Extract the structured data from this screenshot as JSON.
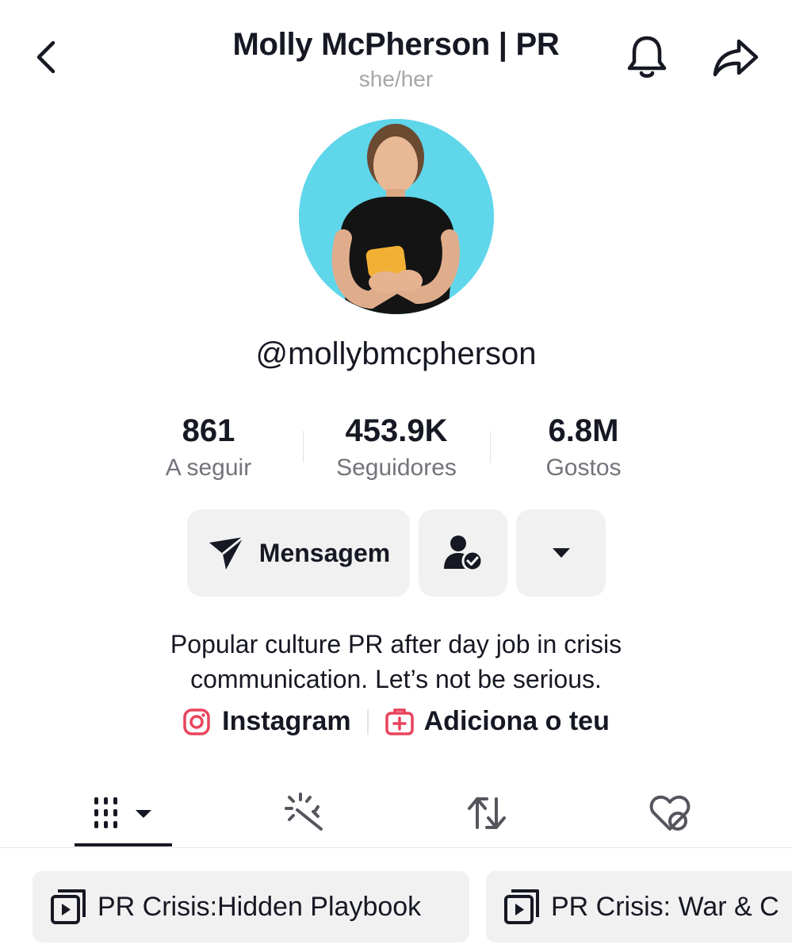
{
  "header": {
    "title": "Molly McPherson | PR",
    "pronouns": "she/her",
    "back_icon": "chevron-left-icon",
    "bell_icon": "bell-icon",
    "share_icon": "share-arrow-icon"
  },
  "profile": {
    "handle": "@mollybmcpherson",
    "avatar_bg_color": "#5fd6ea"
  },
  "stats": [
    {
      "value": "861",
      "label": "A seguir"
    },
    {
      "value": "453.9K",
      "label": "Seguidores"
    },
    {
      "value": "6.8M",
      "label": "Gostos"
    }
  ],
  "actions": {
    "message_label": "Mensagem",
    "message_icon": "send-icon",
    "friend_icon": "user-check-icon",
    "more_icon": "caret-down-icon"
  },
  "bio": {
    "line1": "Popular culture PR after day job in crisis",
    "line2": "communication. Let’s not be serious."
  },
  "links": {
    "instagram_label": "Instagram",
    "add_label": "Adiciona o teu",
    "accent_color": "#e8445c"
  },
  "tabs": [
    {
      "name": "videos",
      "icon": "grid-icon"
    },
    {
      "name": "effects",
      "icon": "magic-wand-icon"
    },
    {
      "name": "reposts",
      "icon": "repost-icon"
    },
    {
      "name": "liked",
      "icon": "heart-hidden-icon"
    }
  ],
  "playlists": [
    {
      "label": "PR Crisis:Hidden Playbook"
    },
    {
      "label": "PR Crisis: War & C"
    }
  ]
}
